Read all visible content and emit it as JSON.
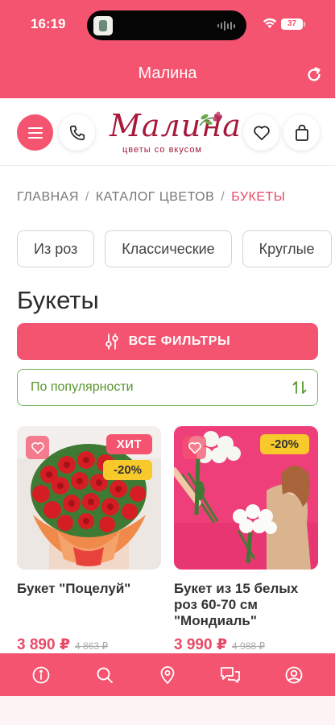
{
  "status_bar": {
    "time": "16:19",
    "battery": "37"
  },
  "app_bar": {
    "title": "Малина",
    "refresh_icon": "refresh-icon"
  },
  "header": {
    "logo_text": "Малина",
    "logo_tagline": "цветы со вкусом",
    "icons": [
      "menu-icon",
      "phone-icon",
      "heart-icon",
      "bag-icon"
    ]
  },
  "breadcrumb": {
    "items": [
      "ГЛАВНАЯ",
      "КАТАЛОГ ЦВЕТОВ",
      "БУКЕТЫ"
    ],
    "separator": "/"
  },
  "categories": [
    "Из роз",
    "Классические",
    "Круглые"
  ],
  "page": {
    "title": "Букеты"
  },
  "filters": {
    "button_label": "ВСЕ ФИЛЬТРЫ"
  },
  "sort": {
    "selected": "По популярности"
  },
  "products": [
    {
      "name": "Букет \"Поцелуй\"",
      "price": "3 890 ₽",
      "old_price": "4 863 ₽",
      "badge": "ХИТ",
      "discount": "-20%"
    },
    {
      "name": "Букет из 15 белых роз 60-70 см \"Мондиаль\"",
      "price": "3 990 ₽",
      "old_price": "4 988 ₽",
      "discount": "-20%"
    }
  ],
  "bottom_nav": [
    "info-icon",
    "search-icon",
    "location-icon",
    "chat-icon",
    "account-icon"
  ],
  "colors": {
    "brand": "#f4546f",
    "logo": "#a6193b",
    "sort_accent": "#78b35e",
    "discount": "#f8c92a"
  }
}
